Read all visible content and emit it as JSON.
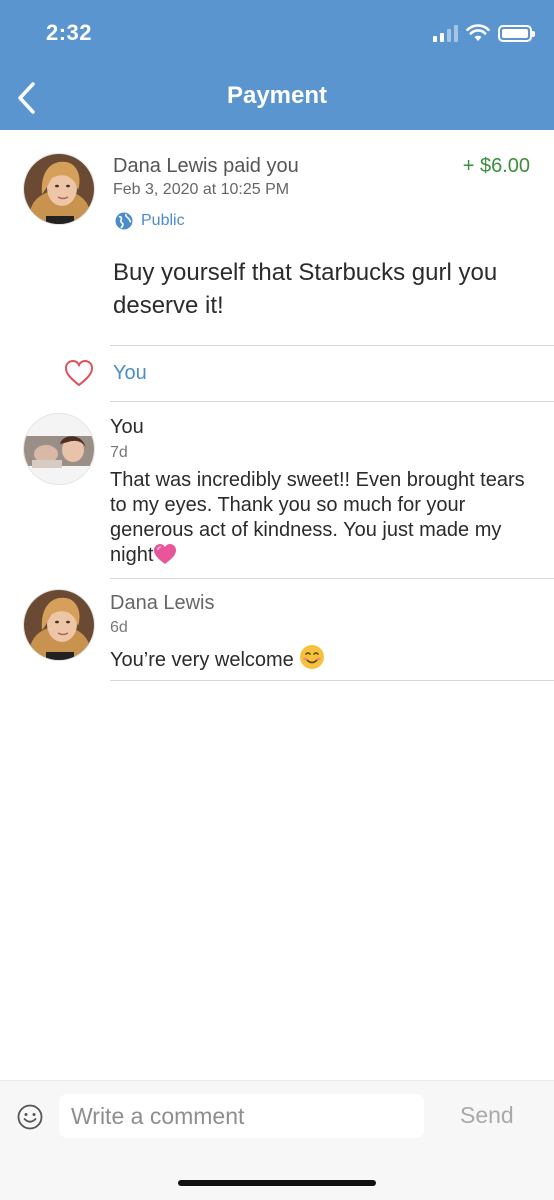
{
  "status_bar": {
    "time": "2:32"
  },
  "header": {
    "title": "Payment"
  },
  "payment": {
    "payer_name": "Dana Lewis",
    "action": "paid you",
    "amount": "+ $6.00",
    "date": "Feb 3, 2020 at 10:25 PM",
    "visibility": "Public",
    "note": "Buy yourself that Starbucks gurl you deserve it!"
  },
  "likes": {
    "names": "You"
  },
  "comments": [
    {
      "author": "You",
      "time": "7d",
      "text": "That was incredibly sweet!! Even brought tears to my eyes. Thank you so much for your generous act of kindness. You just made my night",
      "emoji": "💗"
    },
    {
      "author": "Dana Lewis",
      "time": "6d",
      "text": "You’re very welcome",
      "emoji": "☺️"
    }
  ],
  "composer": {
    "placeholder": "Write a comment",
    "send_label": "Send"
  },
  "icons": {
    "back": "chevron-left-icon",
    "globe": "globe-icon",
    "heart": "heart-outline-icon",
    "emoji": "smiley-icon",
    "signal": "cellular-signal-icon",
    "wifi": "wifi-icon",
    "battery": "battery-icon"
  },
  "colors": {
    "header_bg": "#5b95cf",
    "link_blue": "#4c8ccc",
    "amount_green": "#3d8f3d",
    "heart_red": "#e0505a"
  }
}
